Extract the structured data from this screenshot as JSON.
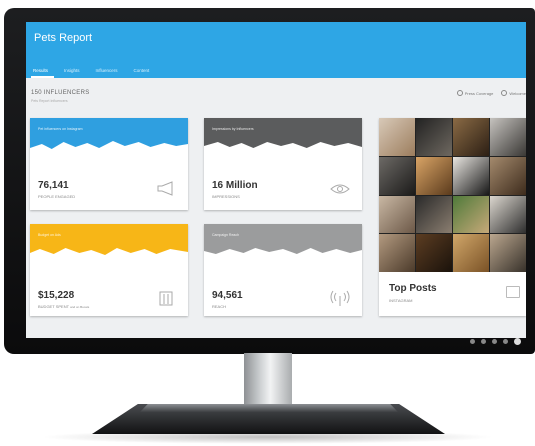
{
  "app": {
    "title": "Pets Report",
    "tabs": [
      {
        "label": "Results",
        "active": true
      },
      {
        "label": "Insights",
        "active": false
      },
      {
        "label": "Influencers",
        "active": false
      },
      {
        "label": "Content",
        "active": false
      }
    ]
  },
  "section": {
    "title": "150 INFLUENCERS",
    "subtitle": "Pets Report Influencers"
  },
  "actions": {
    "coverage_label": "Press Coverage",
    "welcome_label": "Welcome"
  },
  "cards": [
    {
      "band_label": "Pet influencers on Instagram",
      "value": "76,141",
      "label": "PEOPLE ENGAGED",
      "label_suffix": "",
      "color": "#2f9fe0",
      "icon": "megaphone-icon"
    },
    {
      "band_label": "Impressions by Influencers",
      "value": "16 Million",
      "label": "IMPRESSIONS",
      "label_suffix": "",
      "color": "#5b5c5d",
      "icon": "eye-icon"
    },
    {
      "band_label": "Budget on Ads",
      "value": "$15,228",
      "label": "BUDGET SPENT",
      "label_suffix": "and on Boosts",
      "color": "#f7b617",
      "icon": "building-icon"
    },
    {
      "band_label": "Campaign Reach",
      "value": "94,561",
      "label": "REACH",
      "label_suffix": "",
      "color": "#9b9c9d",
      "icon": "broadcast-icon"
    }
  ],
  "top_posts": {
    "title": "Top Posts",
    "subtitle": "INSTAGRAM",
    "icon": "image-icon"
  },
  "colors": {
    "app_bar": "#2ea6e5",
    "accent_blue": "#2f9fe0",
    "accent_yellow": "#f7b617",
    "accent_dark_gray": "#5b5c5d",
    "accent_light_gray": "#9b9c9d"
  }
}
